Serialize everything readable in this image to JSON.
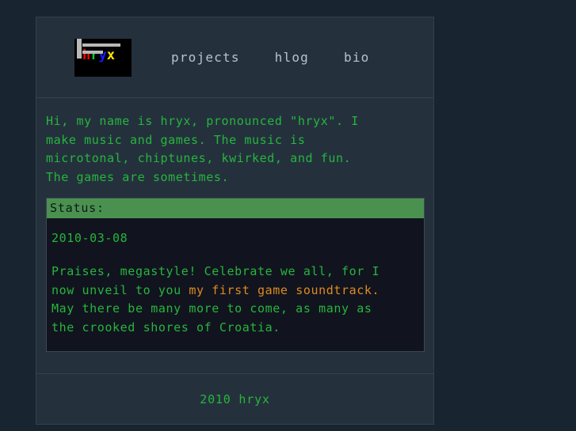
{
  "site": {
    "background_color": "#182430",
    "container_color": "#24313d",
    "accent_green": "#27b53c",
    "accent_orange": "#e08a1e",
    "status_bar_color": "#4a9150",
    "nav_link_color": "#b9c2ca"
  },
  "header": {
    "logo": {
      "name": "hryx-logo",
      "letters": [
        {
          "char": "h",
          "color": "#ff0000"
        },
        {
          "char": "r",
          "color": "#00d020"
        },
        {
          "char": "y",
          "color": "#1a1aff"
        },
        {
          "char": "x",
          "color": "#ffe800"
        }
      ]
    },
    "nav": [
      {
        "label": "projects"
      },
      {
        "label": "hlog"
      },
      {
        "label": "bio"
      }
    ]
  },
  "main": {
    "intro": "Hi, my name is hryx, pronounced \"hryx\". I\nmake music and games. The music is\nmicrotonal, chiptunes, kwirked, and fun.\nThe games are sometimes.",
    "status": {
      "heading": "Status:",
      "date": "2010-03-08",
      "body_before": "Praises, megastyle! Celebrate we all, for I\nnow unveil to you ",
      "link": "my first game soundtrack.",
      "body_after": "\nMay there be many more to come, as many as\nthe crooked shores of Croatia."
    }
  },
  "footer": {
    "copyright": "2010 hryx"
  }
}
